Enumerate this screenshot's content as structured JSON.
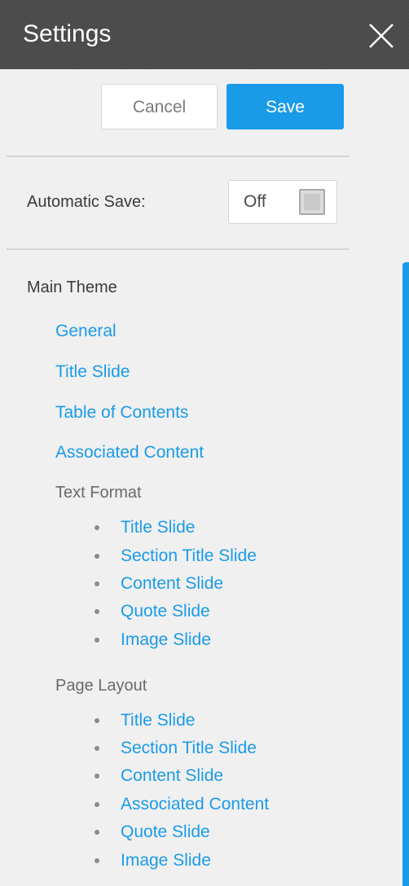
{
  "header": {
    "title": "Settings",
    "close_icon": "close-icon"
  },
  "actions": {
    "cancel_label": "Cancel",
    "save_label": "Save"
  },
  "auto_save": {
    "label": "Automatic Save:",
    "state": "Off"
  },
  "theme": {
    "heading": "Main Theme",
    "links": [
      "General",
      "Title Slide",
      "Table of Contents",
      "Associated Content"
    ],
    "text_format": {
      "label": "Text Format",
      "items": [
        "Title Slide",
        "Section Title Slide",
        "Content Slide",
        "Quote Slide",
        "Image Slide"
      ]
    },
    "page_layout": {
      "label": "Page Layout",
      "items": [
        "Title Slide",
        "Section Title Slide",
        "Content Slide",
        "Associated Content",
        "Quote Slide",
        "Image Slide"
      ]
    }
  },
  "colors": {
    "accent": "#1a9be8",
    "header_bg": "#4a4a4a",
    "panel_bg": "#f0f0f0"
  }
}
